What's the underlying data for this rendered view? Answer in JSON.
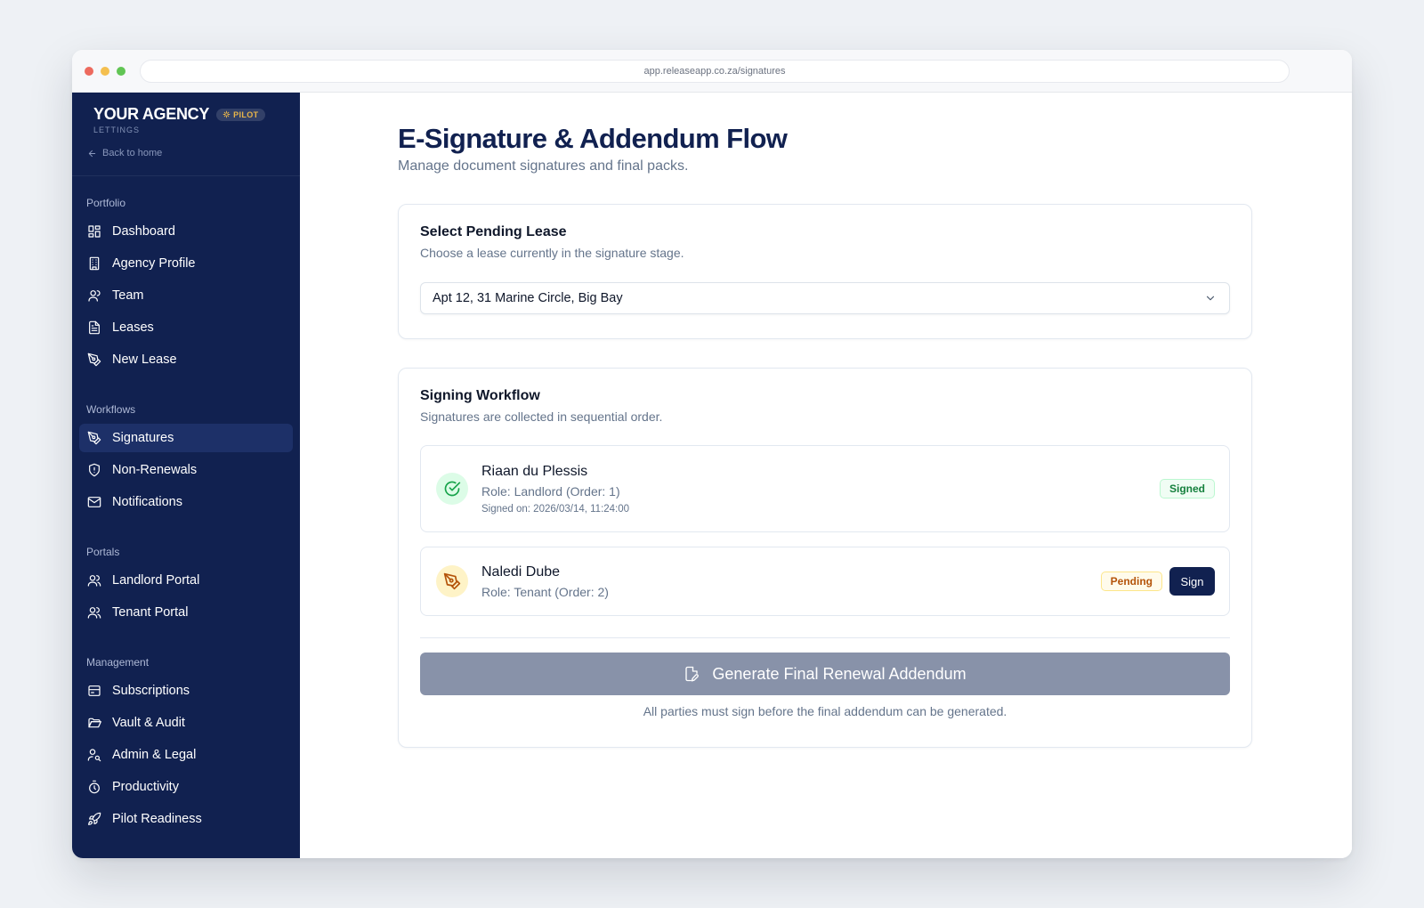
{
  "browser": {
    "url": "app.releaseapp.co.za/signatures",
    "dot_colors": [
      "#ed6a5e",
      "#f4bf4f",
      "#61c554"
    ]
  },
  "brand": {
    "name": "YOUR AGENCY",
    "badge": "PILOT",
    "subtitle": "LETTINGS",
    "back_label": "Back to home"
  },
  "colors": {
    "sidebar_bg": "#112150",
    "active_item_bg": "#1d3068",
    "primary": "#112150",
    "success": "#15803d",
    "warning": "#b45309",
    "disabled_button": "#8892a9"
  },
  "sidebar": {
    "sections": [
      {
        "label": "Portfolio",
        "items": [
          {
            "label": "Dashboard",
            "icon": "dashboard-icon"
          },
          {
            "label": "Agency Profile",
            "icon": "building-icon"
          },
          {
            "label": "Team",
            "icon": "user-icon"
          },
          {
            "label": "Leases",
            "icon": "file-text-icon"
          },
          {
            "label": "New Lease",
            "icon": "pen-tool-icon"
          }
        ]
      },
      {
        "label": "Workflows",
        "items": [
          {
            "label": "Signatures",
            "icon": "pen-tool-icon",
            "active": true
          },
          {
            "label": "Non-Renewals",
            "icon": "shield-icon"
          },
          {
            "label": "Notifications",
            "icon": "mail-icon"
          }
        ]
      },
      {
        "label": "Portals",
        "items": [
          {
            "label": "Landlord Portal",
            "icon": "users-icon"
          },
          {
            "label": "Tenant Portal",
            "icon": "users-icon"
          }
        ]
      },
      {
        "label": "Management",
        "items": [
          {
            "label": "Subscriptions",
            "icon": "receipt-icon"
          },
          {
            "label": "Vault & Audit",
            "icon": "folder-open-icon"
          },
          {
            "label": "Admin & Legal",
            "icon": "user-key-icon"
          },
          {
            "label": "Productivity",
            "icon": "timer-icon"
          },
          {
            "label": "Pilot Readiness",
            "icon": "rocket-icon"
          }
        ]
      }
    ]
  },
  "page": {
    "title": "E-Signature & Addendum Flow",
    "subtitle": "Manage document signatures and final packs."
  },
  "lease_select": {
    "title": "Select Pending Lease",
    "description": "Choose a lease currently in the signature stage.",
    "selected": "Apt 12, 31 Marine Circle, Big Bay"
  },
  "workflow": {
    "title": "Signing Workflow",
    "description": "Signatures are collected in sequential order.",
    "signers": [
      {
        "name": "Riaan du Plessis",
        "role": "Role: Landlord (Order: 1)",
        "signed_on": "Signed on: 2026/03/14, 11:24:00",
        "status": "Signed"
      },
      {
        "name": "Naledi Dube",
        "role": "Role: Tenant (Order: 2)",
        "status": "Pending",
        "action": "Sign"
      }
    ],
    "generate_label": "Generate Final Renewal Addendum",
    "generate_note": "All parties must sign before the final addendum can be generated."
  }
}
